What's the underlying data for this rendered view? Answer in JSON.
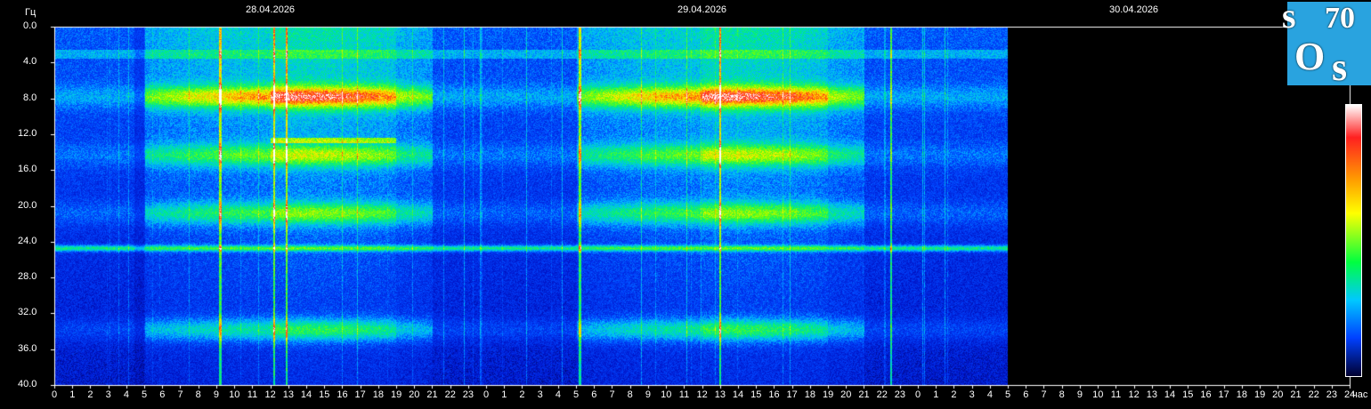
{
  "chart_data": {
    "type": "heatmap",
    "title": "",
    "ylabel": "Гц",
    "xlabel": "час",
    "ylim": [
      0,
      40
    ],
    "y_ticks": [
      "0.0",
      "4.0",
      "8.0",
      "12.0",
      "16.0",
      "20.0",
      "24.0",
      "28.0",
      "32.0",
      "36.0",
      "40.0"
    ],
    "x_ticks": [
      "0",
      "1",
      "2",
      "3",
      "4",
      "5",
      "6",
      "7",
      "8",
      "9",
      "10",
      "11",
      "12",
      "13",
      "14",
      "15",
      "16",
      "17",
      "18",
      "19",
      "20",
      "21",
      "22",
      "23",
      "0",
      "1",
      "2",
      "3",
      "4",
      "5",
      "6",
      "7",
      "8",
      "9",
      "10",
      "11",
      "12",
      "13",
      "14",
      "15",
      "16",
      "17",
      "18",
      "19",
      "20",
      "21",
      "22",
      "23",
      "0",
      "1",
      "2",
      "3",
      "4",
      "5",
      "6",
      "7",
      "8",
      "9",
      "10",
      "11",
      "12",
      "13",
      "14",
      "15",
      "16",
      "17",
      "18",
      "19",
      "20",
      "21",
      "22",
      "23",
      "24"
    ],
    "dates": [
      "28.04.2026",
      "29.04.2026",
      "30.04.2026"
    ],
    "data_end_hour": 53,
    "total_hours": 72,
    "bands_hz": [
      7.8,
      14.3,
      20.8,
      24.7,
      33.8
    ],
    "colorscale": [
      "#000030",
      "#0040ff",
      "#00c8ff",
      "#00ff40",
      "#ffff00",
      "#ffa000",
      "#ff2020",
      "#ffffff"
    ]
  },
  "logo": {
    "s1": "s",
    "num": "70",
    "o": "O",
    "s2": "s"
  }
}
